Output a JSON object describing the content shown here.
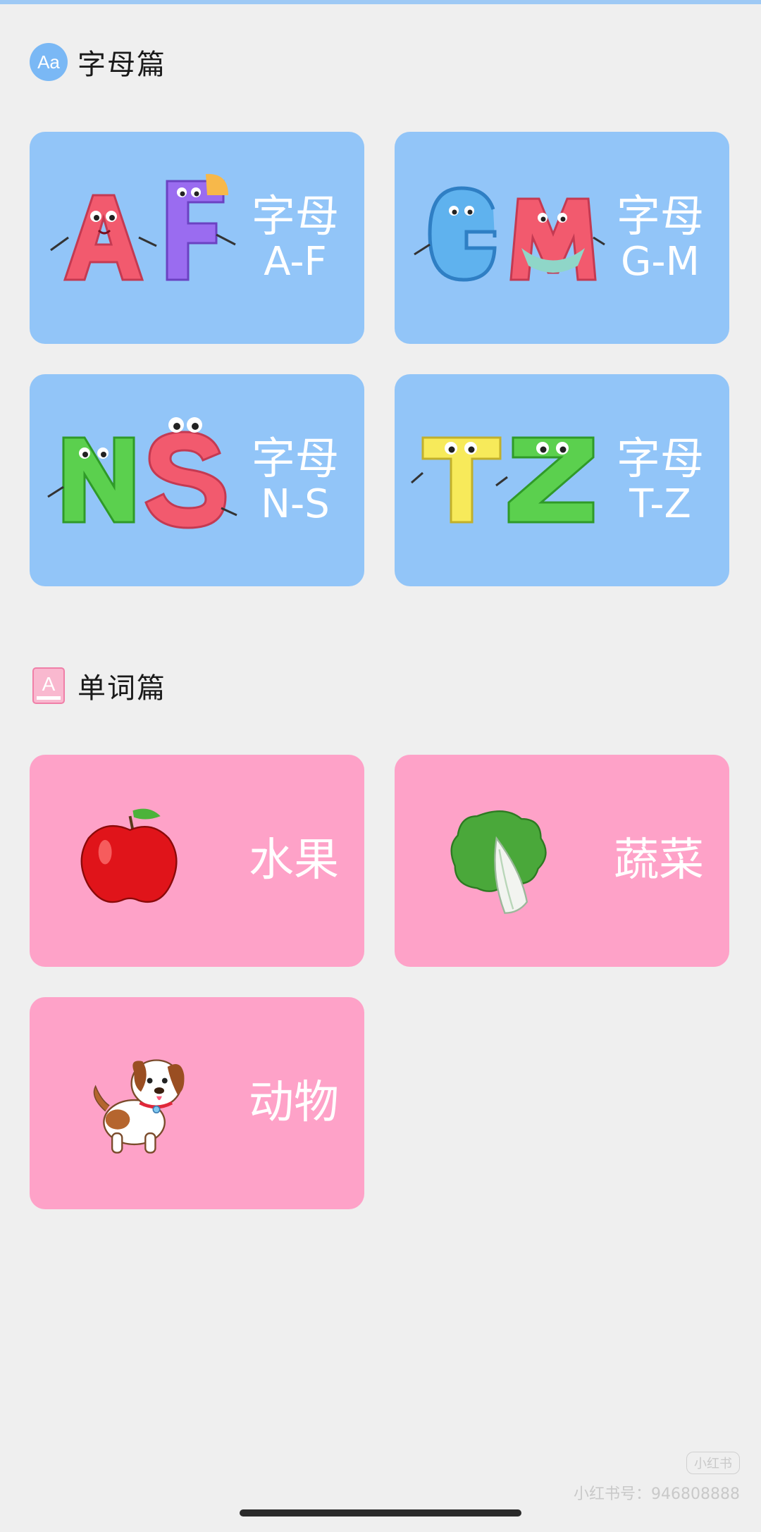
{
  "colors": {
    "letter_card": "#92c5f8",
    "word_card": "#fea2c8",
    "background": "#efefef"
  },
  "letters_section": {
    "icon": "aa-font-icon",
    "icon_text": "Aa",
    "title": "字母篇",
    "cards": [
      {
        "line1": "字母",
        "line2": "A-F",
        "art": "cartoon-letters-a-f"
      },
      {
        "line1": "字母",
        "line2": "G-M",
        "art": "cartoon-letters-g-m"
      },
      {
        "line1": "字母",
        "line2": "N-S",
        "art": "cartoon-letters-n-s"
      },
      {
        "line1": "字母",
        "line2": "T-Z",
        "art": "cartoon-letters-t-z"
      }
    ]
  },
  "words_section": {
    "icon": "book-a-icon",
    "icon_text": "A",
    "title": "单词篇",
    "cards": [
      {
        "label": "水果",
        "art": "apple-icon"
      },
      {
        "label": "蔬菜",
        "art": "cabbage-icon"
      },
      {
        "label": "动物",
        "art": "puppy-icon"
      }
    ]
  },
  "watermark": {
    "badge": "小红书",
    "text": "小红书号：946808888"
  }
}
